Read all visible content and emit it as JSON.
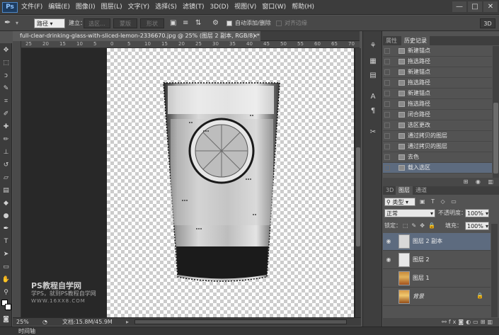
{
  "app": {
    "logo": "Ps"
  },
  "menu": [
    "文件(F)",
    "编辑(E)",
    "图像(I)",
    "图层(L)",
    "文字(Y)",
    "选择(S)",
    "滤镜(T)",
    "3D(D)",
    "视图(V)",
    "窗口(W)",
    "帮助(H)"
  ],
  "window_controls": [
    "—",
    "□",
    "✕"
  ],
  "options": {
    "path_mode": "路径",
    "make_label": "建立：",
    "selection_btn": "选区...",
    "mask_btn": "蒙版",
    "shape_btn": "形状",
    "auto_add_delete": "自动添加/删除",
    "align_edges": "对齐边缘",
    "workspace": "3D"
  },
  "document": {
    "tab_title": "full-clear-drinking-glass-with-sliced-lemon-2336670.jpg @ 25% (图层 2 副本, RGB/8) *",
    "close": "×"
  },
  "ruler_marks": [
    "25",
    "20",
    "15",
    "10",
    "5",
    "0",
    "5",
    "10",
    "15",
    "20",
    "25",
    "30",
    "35",
    "40",
    "45",
    "50",
    "55",
    "60",
    "65",
    "70"
  ],
  "watermark": {
    "title": "PS教程自学网",
    "subtitle": "学PS，就到PS教程自学网",
    "url": "WWW.16XX8.COM"
  },
  "status": {
    "zoom": "25%",
    "doc_info": "文档:15.8M/45.9M"
  },
  "timeline": {
    "label": "时间轴"
  },
  "history": {
    "tabs": [
      "属性",
      "历史记录"
    ],
    "items": [
      {
        "label": "新建锚点"
      },
      {
        "label": "拖选路径"
      },
      {
        "label": "新建锚点"
      },
      {
        "label": "拖选路径"
      },
      {
        "label": "新建锚点"
      },
      {
        "label": "拖选路径"
      },
      {
        "label": "闭合路径"
      },
      {
        "label": "选区更改"
      },
      {
        "label": "通过拷贝的图层"
      },
      {
        "label": "通过拷贝的图层"
      },
      {
        "label": "去色"
      },
      {
        "label": "载入选区"
      }
    ],
    "active_index": 11
  },
  "layers": {
    "tabs": [
      "3D",
      "图层",
      "通道"
    ],
    "filter": "类型",
    "blend_mode": "正常",
    "opacity_label": "不透明度：",
    "opacity": "100%",
    "lock_label": "锁定：",
    "fill_label": "填充：",
    "fill": "100%",
    "items": [
      {
        "name": "图层 2 副本",
        "visible": true
      },
      {
        "name": "图层 2",
        "visible": true
      },
      {
        "name": "图层 1",
        "visible": false
      },
      {
        "name": "背景",
        "visible": false,
        "locked": true
      }
    ],
    "active_index": 0
  }
}
